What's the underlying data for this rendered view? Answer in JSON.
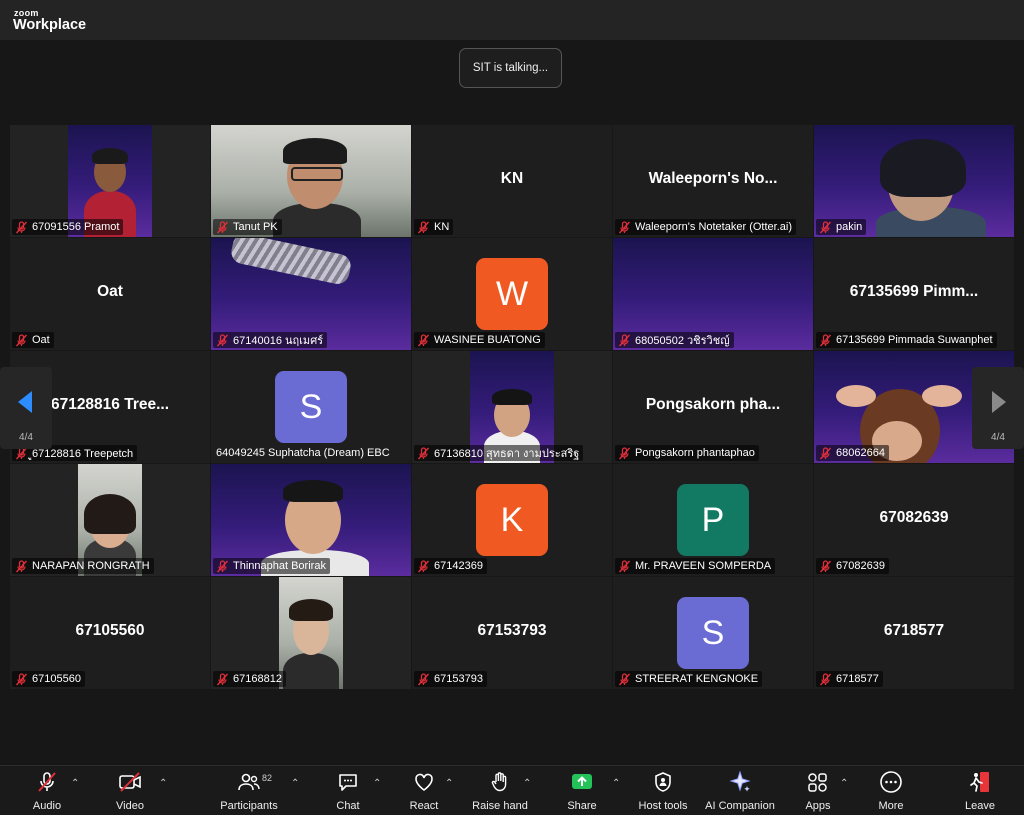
{
  "app": {
    "brand_top": "zoom",
    "brand_main": "Workplace"
  },
  "banner": {
    "talking": "SIT is talking..."
  },
  "tiles": {
    "t1": {
      "label": "67091556 Pramot"
    },
    "t2": {
      "label": "Tanut PK"
    },
    "t3": {
      "big": "KN",
      "label": "KN"
    },
    "t4": {
      "big": "Waleeporn's No...",
      "label": "Waleeporn's Notetaker (Otter.ai)"
    },
    "t5": {
      "label": "pakin"
    },
    "t6": {
      "big": "Oat",
      "label": "Oat"
    },
    "t7": {
      "label": "67140016 นฤเมศร์"
    },
    "t8": {
      "avatar": "W",
      "label": "WASINEE BUATONG"
    },
    "t9": {
      "label": "68050502 วชิรวิชญ์"
    },
    "t10": {
      "big": "67135699  Pimm...",
      "label": "67135699 Pimmada Suwanphet"
    },
    "t11": {
      "big": "67128816  Tree...",
      "label": "ู67128816 Treepetch"
    },
    "t12": {
      "avatar": "S",
      "label": "64049245 Suphatcha (Dream) EBC"
    },
    "t13": {
      "label": "67136810 สุทธดา งามประสริฐ"
    },
    "t14": {
      "big": "Pongsakorn  pha...",
      "label": "Pongsakorn phantaphao"
    },
    "t15": {
      "label": "68062664"
    },
    "t16": {
      "label": "NARAPAN RONGRATH"
    },
    "t17": {
      "label": "Thinnaphat Borirak"
    },
    "t18": {
      "avatar": "K",
      "label": "67142369"
    },
    "t19": {
      "avatar": "P",
      "label": "Mr. PRAVEEN SOMPERDA"
    },
    "t20": {
      "big": "67082639",
      "label": "67082639"
    },
    "t21": {
      "big": "67105560",
      "label": "67105560"
    },
    "t22": {
      "label": "67168812"
    },
    "t23": {
      "big": "67153793",
      "label": "67153793"
    },
    "t24": {
      "avatar": "S",
      "label": "STREERAT KENGNOKE"
    },
    "t25": {
      "big": "6718577",
      "label": "6718577"
    }
  },
  "nav": {
    "prev_page": "4/4",
    "next_page": "4/4"
  },
  "toolbar": {
    "audio": "Audio",
    "video": "Video",
    "participants": "Participants",
    "participants_count": "82",
    "chat": "Chat",
    "react": "React",
    "raise_hand": "Raise hand",
    "share": "Share",
    "host_tools": "Host tools",
    "ai_companion": "AI Companion",
    "apps": "Apps",
    "more": "More",
    "leave": "Leave"
  },
  "colors": {
    "avatar_orange": "#f05a22",
    "avatar_purple": "#6a6bd3",
    "avatar_teal": "#127a62",
    "share_green": "#23c35a",
    "leave_red": "#e8353a",
    "mic_red": "#e02f3a"
  }
}
